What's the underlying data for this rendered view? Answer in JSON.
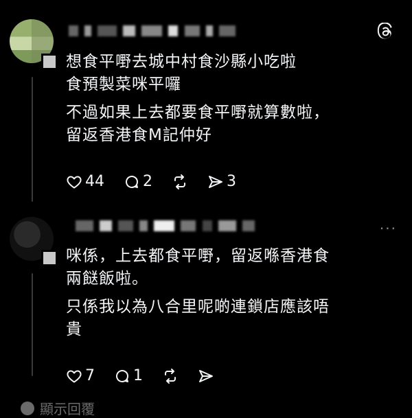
{
  "posts": [
    {
      "text_lines": [
        "想食平嘢去城中村食沙縣小吃啦",
        "食預製菜咪平囉",
        "",
        "不過如果上去都要食平嘢就算數啦，",
        "留返香港食M記仲好"
      ],
      "likes": "44",
      "comments": "2",
      "shares": "3"
    },
    {
      "text_lines": [
        "咪係，上去都食平嘢，留返喺香港食",
        "兩餸飯啦。",
        "",
        "只係我以為八合里呢啲連鎖店應該唔",
        "貴"
      ],
      "likes": "7",
      "comments": "1"
    }
  ],
  "show_replies_label": "顯示回覆"
}
